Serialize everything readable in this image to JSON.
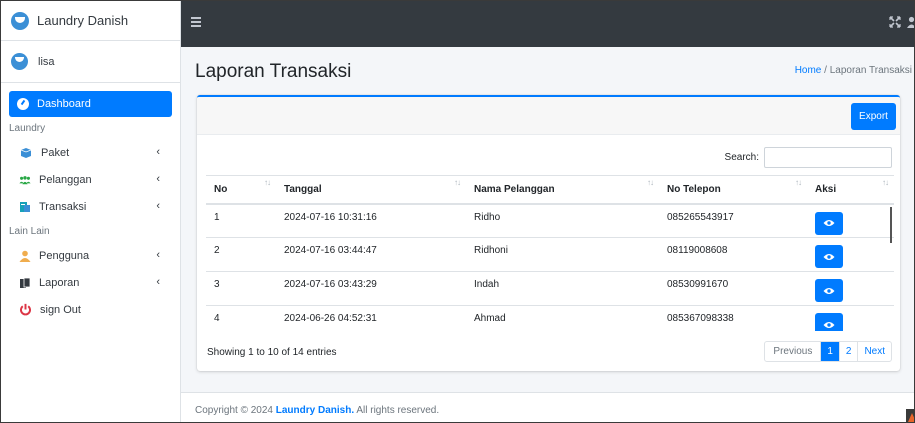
{
  "sidebar": {
    "brand": "Laundry Danish",
    "user": "lisa",
    "dashboard": "Dashboard",
    "header_laundry": "Laundry",
    "paket": "Paket",
    "pelanggan": "Pelanggan",
    "transaksi": "Transaksi",
    "header_lain": "Lain Lain",
    "pengguna": "Pengguna",
    "laporan": "Laporan",
    "signout": "sign Out",
    "chevron": "‹"
  },
  "main": {
    "title": "Laporan Transaksi",
    "breadcrumb_home": "Home",
    "breadcrumb_sep": "/",
    "breadcrumb_current": "Laporan Transaksi",
    "export_label": "Export",
    "search_label": "Search:",
    "search_value": "",
    "info": "Showing 1 to 10 of 14 entries",
    "sort_glyph": "↑↓"
  },
  "table": {
    "headers": [
      "No",
      "Tanggal",
      "Nama Pelanggan",
      "No Telepon",
      "Aksi"
    ],
    "rows": [
      [
        "1",
        "2024-07-16 10:31:16",
        "Ridho",
        "085265543917"
      ],
      [
        "2",
        "2024-07-16 03:44:47",
        "Ridhoni",
        "08119008608"
      ],
      [
        "3",
        "2024-07-16 03:43:29",
        "Indah",
        "08530991670"
      ],
      [
        "4",
        "2024-06-26 04:52:31",
        "Ahmad",
        "085367098338"
      ]
    ]
  },
  "pagination": {
    "previous": "Previous",
    "page1": "1",
    "page2": "2",
    "next": "Next"
  },
  "footer": {
    "prefix": "Copyright © 2024",
    "brand": "Laundry Danish.",
    "suffix": "All rights reserved."
  },
  "colors": {
    "primary": "#007bff",
    "topbar": "#343a40",
    "danger": "#dc3545",
    "warning": "#f0ad4e",
    "success": "#28a745"
  },
  "icons": {
    "dashboard": "dashboard-icon",
    "paket": "box-icon",
    "pelanggan": "users-icon",
    "transaksi": "receipt-icon",
    "pengguna": "user-icon",
    "laporan": "copy-icon",
    "signout": "power-icon",
    "aksi": "eye-icon"
  }
}
